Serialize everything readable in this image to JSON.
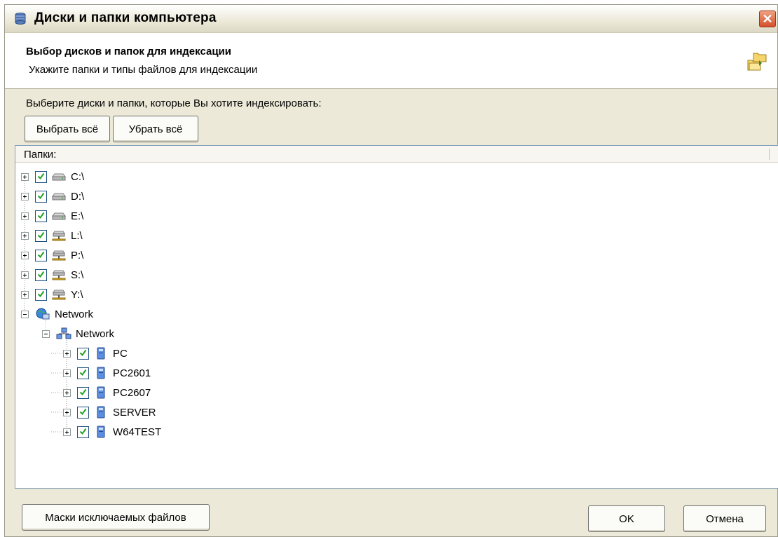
{
  "window": {
    "title": "Диски и папки компьютера",
    "close_icon": "close-icon"
  },
  "header": {
    "title": "Выбор дисков и папок для индексации",
    "subtitle": "Укажите папки и типы файлов для индексации",
    "icon": "folders-icon"
  },
  "prompt": "Выберите диски и папки, которые Вы хотите индексировать:",
  "toolbar": {
    "select_all_label": "Выбрать всё",
    "clear_all_label": "Убрать всё"
  },
  "tree": {
    "column_header": "Папки:",
    "nodes": [
      {
        "label": "C:\\",
        "type": "drive",
        "checked": true,
        "expanded": false
      },
      {
        "label": "D:\\",
        "type": "drive",
        "checked": true,
        "expanded": false
      },
      {
        "label": "E:\\",
        "type": "drive",
        "checked": true,
        "expanded": false
      },
      {
        "label": "L:\\",
        "type": "network-drive",
        "checked": true,
        "expanded": false
      },
      {
        "label": "P:\\",
        "type": "network-drive",
        "checked": true,
        "expanded": false
      },
      {
        "label": "S:\\",
        "type": "network-drive",
        "checked": true,
        "expanded": false
      },
      {
        "label": "Y:\\",
        "type": "network-drive",
        "checked": true,
        "expanded": false
      },
      {
        "label": "Network",
        "type": "network",
        "checked": null,
        "expanded": true
      },
      {
        "label": "Network",
        "type": "workgroup",
        "checked": null,
        "expanded": true
      },
      {
        "label": "PC",
        "type": "computer",
        "checked": true,
        "expanded": false
      },
      {
        "label": "PC2601",
        "type": "computer",
        "checked": true,
        "expanded": false
      },
      {
        "label": "PC2607",
        "type": "computer",
        "checked": true,
        "expanded": false
      },
      {
        "label": "SERVER",
        "type": "computer",
        "checked": true,
        "expanded": false
      },
      {
        "label": "W64TEST",
        "type": "computer",
        "checked": true,
        "expanded": false
      }
    ]
  },
  "footer": {
    "masks_label": "Маски исключаемых файлов",
    "ok_label": "OK",
    "cancel_label": "Отмена"
  },
  "colors": {
    "dialog_bg": "#ece9d8",
    "checkbox_border": "#1c5180",
    "checkmark": "#21a121",
    "close_button": "#d4502c"
  }
}
